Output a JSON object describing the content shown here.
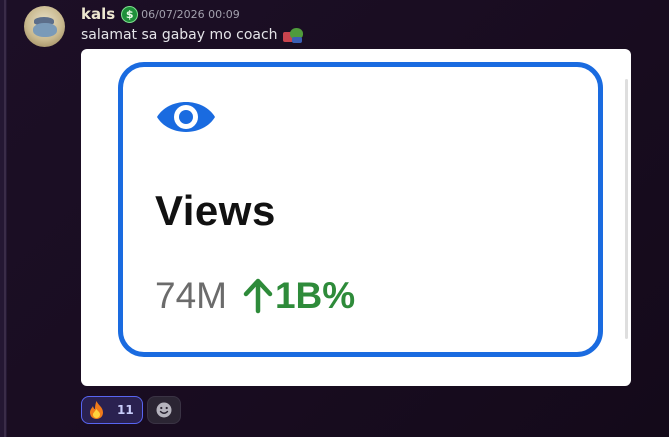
{
  "message": {
    "username": "kals",
    "badge_symbol": "$",
    "timestamp": "06/07/2026 00:09",
    "text": "salamat sa gabay mo coach",
    "sticker_icon": "frog-gift-emoji"
  },
  "attachment": {
    "icon": "eye-icon",
    "title": "Views",
    "value": "74M",
    "trend_icon": "arrow-up-icon",
    "change": "1B%",
    "colors": {
      "frame": "#1a6be0",
      "eye": "#1a6be0",
      "change": "#2e8b3a",
      "value": "#6b6b6b"
    }
  },
  "reactions": [
    {
      "icon": "fire-emoji-icon",
      "count": "11",
      "active": true
    }
  ],
  "add_reaction_icon": "add-reaction-icon"
}
